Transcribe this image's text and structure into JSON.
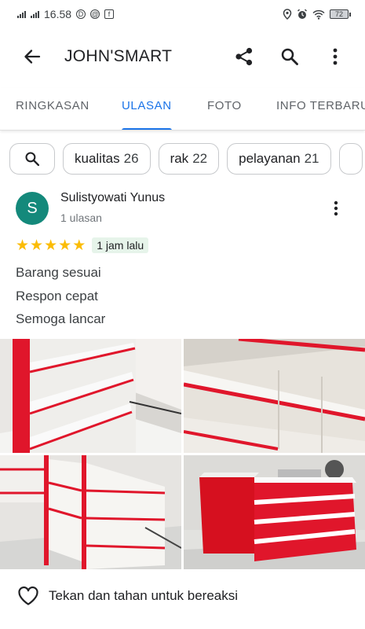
{
  "status_bar": {
    "time": "16.58",
    "battery": "72"
  },
  "app_bar": {
    "title": "JOHN'SMART",
    "icons": [
      "back-arrow-icon",
      "share-icon",
      "search-icon",
      "more-vert-icon"
    ]
  },
  "tabs": [
    {
      "label": "RINGKASAN",
      "active": false
    },
    {
      "label": "ULASAN",
      "active": true
    },
    {
      "label": "FOTO",
      "active": false
    },
    {
      "label": "INFO TERBARU",
      "active": false
    }
  ],
  "chips": [
    {
      "label": "kualitas",
      "count": "26"
    },
    {
      "label": "rak",
      "count": "22"
    },
    {
      "label": "pelayanan",
      "count": "21"
    }
  ],
  "review": {
    "avatar_initial": "S",
    "avatar_color": "#14897b",
    "reviewer_name": "Sulistyowati Yunus",
    "reviewer_sub": "1 ulasan",
    "rating": 5,
    "time": "1 jam lalu",
    "text_lines": [
      "Barang sesuai",
      "Respon cepat",
      "Semoga lancar"
    ]
  },
  "react_bar": {
    "label": "Tekan dan tahan untuk bereaksi"
  },
  "colors": {
    "accent": "#1a73e8",
    "star": "#fbbc04",
    "badge_bg": "#e6f4ea",
    "shelf_red": "#e0162b"
  }
}
